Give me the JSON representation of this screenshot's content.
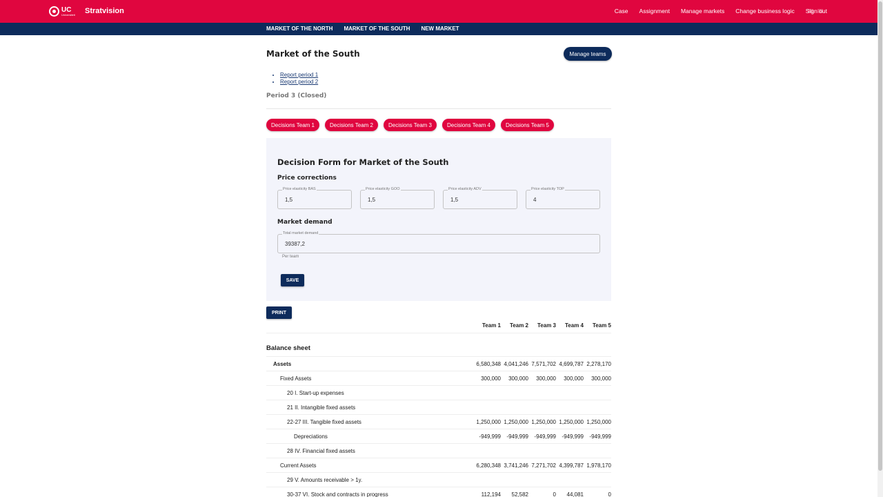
{
  "header": {
    "logo_text": "UC",
    "logo_subtext": "Universiteit",
    "brand": "Stratvision",
    "nav": [
      "Case",
      "Assignment",
      "Manage markets",
      "Change business logic",
      "Sign out"
    ]
  },
  "subnav": {
    "items": [
      "MARKET OF THE NORTH",
      "MARKET OF THE SOUTH",
      "NEW MARKET"
    ]
  },
  "page": {
    "title": "Market of the South",
    "manage_teams": "Manage teams",
    "reports": [
      "Report period 1",
      "Report period 2"
    ],
    "period": "Period 3 (Closed)",
    "team_buttons": [
      "Decisions Team 1",
      "Decisions Team 2",
      "Decisions Team 3",
      "Decisions Team 4",
      "Decisions Team 5"
    ]
  },
  "form": {
    "title": "Decision Form for Market of the South",
    "price_section": "Price corrections",
    "price_fields": [
      {
        "label": "Price elasticity BAS",
        "value": "1,5"
      },
      {
        "label": "Price elasticity GOO",
        "value": "1,5"
      },
      {
        "label": "Price elasticity ADV",
        "value": "1,5"
      },
      {
        "label": "Price elasticity TOP",
        "value": "4"
      }
    ],
    "demand_section": "Market demand",
    "demand_field": {
      "label": "Total market demand",
      "value": "39387,2",
      "helper": "Per team"
    },
    "save": "SAVE"
  },
  "print": "PRINT",
  "table": {
    "headers": [
      "Team 1",
      "Team 2",
      "Team 3",
      "Team 4",
      "Team 5"
    ],
    "section_title": "Balance sheet",
    "rows": [
      {
        "label": "Assets",
        "level": 1,
        "bold": true,
        "values": [
          "6,580,348",
          "4,041,246",
          "7,571,702",
          "4,699,787",
          "2,278,170"
        ]
      },
      {
        "label": "Fixed Assets",
        "level": 2,
        "bold": false,
        "values": [
          "300,000",
          "300,000",
          "300,000",
          "300,000",
          "300,000"
        ]
      },
      {
        "label": "20 I. Start-up expenses",
        "level": 3,
        "bold": false,
        "values": [
          "",
          "",
          "",
          "",
          ""
        ]
      },
      {
        "label": "21 II. Intangible fixed assets",
        "level": 3,
        "bold": false,
        "values": [
          "",
          "",
          "",
          "",
          ""
        ]
      },
      {
        "label": "22-27 III. Tangible fixed assets",
        "level": 3,
        "bold": false,
        "values": [
          "1,250,000",
          "1,250,000",
          "1,250,000",
          "1,250,000",
          "1,250,000"
        ]
      },
      {
        "label": "Depreciations",
        "level": 4,
        "bold": false,
        "values": [
          "-949,999",
          "-949,999",
          "-949,999",
          "-949,999",
          "-949,999"
        ]
      },
      {
        "label": "28 IV. Financial fixed assets",
        "level": 3,
        "bold": false,
        "values": [
          "",
          "",
          "",
          "",
          ""
        ]
      },
      {
        "label": "Current Assets",
        "level": 2,
        "bold": false,
        "values": [
          "6,280,348",
          "3,741,246",
          "7,271,702",
          "4,399,787",
          "1,978,170"
        ]
      },
      {
        "label": "29 V. Amounts receivable > 1y.",
        "level": 3,
        "bold": false,
        "values": [
          "",
          "",
          "",
          "",
          ""
        ]
      },
      {
        "label": "30-37 VI. Stock and contracts in progress",
        "level": 3,
        "bold": false,
        "values": [
          "112,194",
          "52,582",
          "0",
          "44,081",
          "0"
        ]
      }
    ]
  }
}
